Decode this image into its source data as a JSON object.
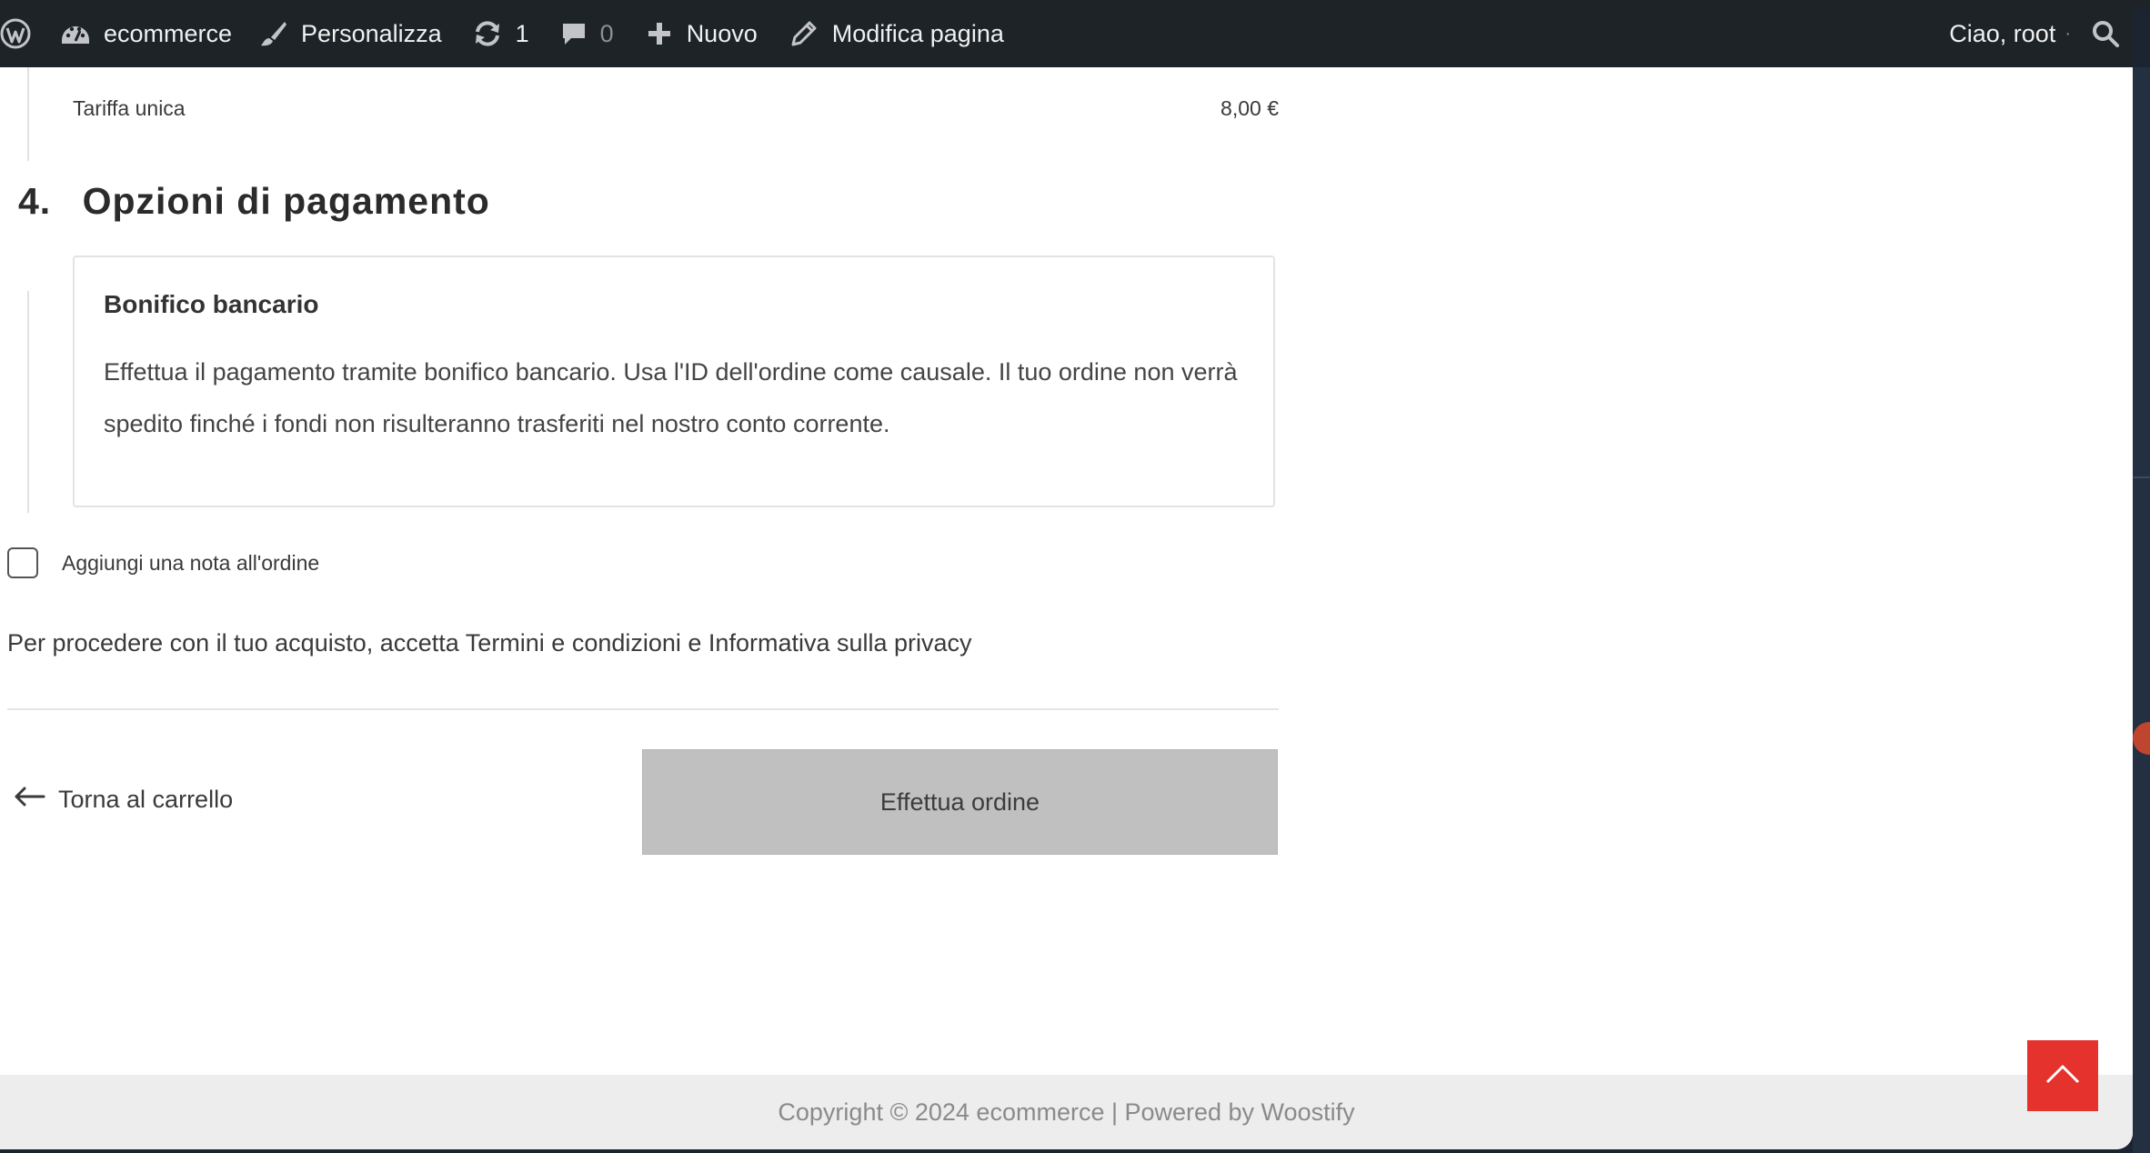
{
  "admin_bar": {
    "site_name": "ecommerce",
    "customize_label": "Personalizza",
    "updates_count": "1",
    "comments_count": "0",
    "new_label": "Nuovo",
    "edit_page_label": "Modifica pagina",
    "greeting": "Ciao, root",
    "icons": [
      "wordpress-icon",
      "dashboard-icon",
      "brush-icon",
      "updates-icon",
      "comments-icon",
      "plus-icon",
      "pencil-icon",
      "search-icon"
    ]
  },
  "shipping": {
    "label": "Tariffa unica",
    "price": "8,00 €"
  },
  "payment_section": {
    "step_number": "4.",
    "title": "Opzioni di pagamento",
    "method_title": "Bonifico bancario",
    "method_description": "Effettua il pagamento tramite bonifico bancario. Usa l'ID dell'ordine come causale. Il tuo ordine non verrà spedito finché i fondi non risulteranno trasferiti nel nostro conto corrente."
  },
  "order_note": {
    "label": "Aggiungi una nota all'ordine",
    "checked": false
  },
  "terms_text": "Per procedere con il tuo acquisto, accetta Termini e condizioni e Informativa sulla privacy",
  "actions": {
    "back_label": "Torna al carrello",
    "place_order_label": "Effettua ordine"
  },
  "footer": {
    "copyright": "Copyright © 2024 ecommerce | Powered by Woostify"
  },
  "colors": {
    "admin_bar_bg": "#1d2327",
    "place_order_bg": "#c0c0c0",
    "back_to_top_bg": "#e5322d",
    "footer_bg": "#ededed"
  }
}
